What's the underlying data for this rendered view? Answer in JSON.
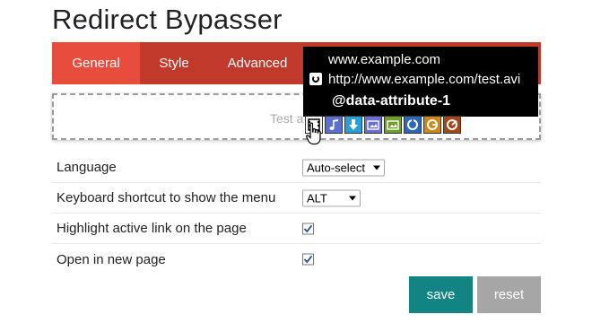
{
  "app": {
    "title": "Redirect Bypasser"
  },
  "tabs": [
    {
      "label": "General",
      "active": true
    },
    {
      "label": "Style",
      "active": false
    },
    {
      "label": "Advanced",
      "active": false
    }
  ],
  "test_area": {
    "text": "Test a"
  },
  "popup": {
    "url_primary": "www.example.com",
    "url_secondary": "http://www.example.com/test.avi",
    "attribute": "@data-attribute-1",
    "icons": [
      "film-icon",
      "music-note-icon",
      "download-icon",
      "image-icon",
      "image-search-icon",
      "blank-anchor-icon",
      "google-icon",
      "lastfm-icon"
    ]
  },
  "settings": {
    "language": {
      "label": "Language",
      "value": "Auto-select"
    },
    "shortcut": {
      "label": "Keyboard shortcut to show the menu",
      "value": "ALT"
    },
    "highlight": {
      "label": "Highlight active link on the page",
      "checked": true
    },
    "new_page": {
      "label": "Open in new page",
      "checked": true
    }
  },
  "buttons": {
    "save": "save",
    "reset": "reset"
  },
  "colors": {
    "tab_bar": "#c0392b",
    "tab_active": "#e74c3c",
    "save": "#138484",
    "reset": "#a6a6a6"
  }
}
